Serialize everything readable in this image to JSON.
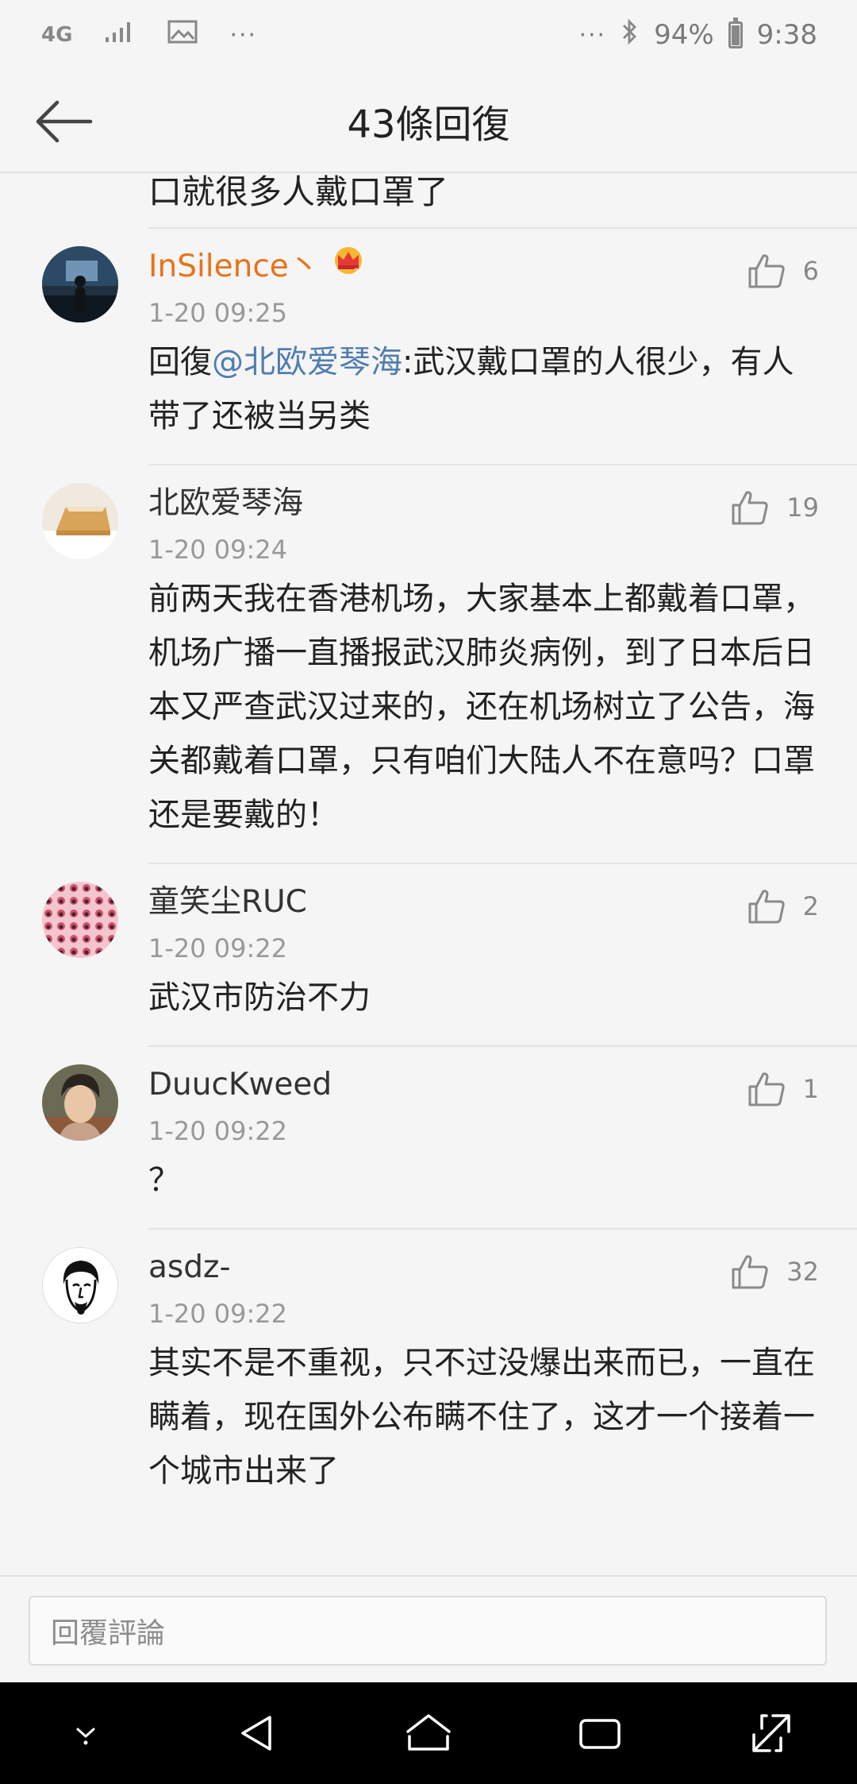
{
  "status_bar": {
    "network": "4G",
    "left_more": "···",
    "right_more": "···",
    "battery": "94%",
    "time": "9:38"
  },
  "header": {
    "title": "43條回復"
  },
  "list": {
    "tail_text": "口就很多人戴口罩了",
    "comments": [
      {
        "name": "InSilence丶",
        "time": "1-20 09:25",
        "likes": "6",
        "reply_prefix": "回復",
        "mention": "@北欧爱琴海",
        "text": ":武汉戴口罩的人很少，有人带了还被当另类",
        "avatar": "night-silhouette"
      },
      {
        "name": "北欧爱琴海",
        "time": "1-20 09:24",
        "likes": "19",
        "text": "前两天我在香港机场，大家基本上都戴着口罩，机场广播一直播报武汉肺炎病例，到了日本后日本又严查武汉过来的，还在机场树立了公告，海关都戴着口罩，只有咱们大陆人不在意吗？口罩还是要戴的！",
        "avatar": "cake"
      },
      {
        "name": "童笑尘RUC",
        "time": "1-20 09:22",
        "likes": "2",
        "text": "武汉市防治不力",
        "avatar": "pink-pattern"
      },
      {
        "name": "DuucKweed",
        "time": "1-20 09:22",
        "likes": "1",
        "text": "？",
        "avatar": "portrait"
      },
      {
        "name": "asdz-",
        "time": "1-20 09:22",
        "likes": "32",
        "text": "其实不是不重视，只不过没爆出来而已，一直在瞒着，现在国外公布瞒不住了，这才一个接着一个城市出来了",
        "avatar": "shakespeare-sketch"
      }
    ]
  },
  "reply_bar": {
    "placeholder": "回覆評論"
  },
  "colors": {
    "vip_name": "#e8731a",
    "mention": "#507daf",
    "background": "#f5f5f5",
    "nav_bar": "#000000"
  }
}
